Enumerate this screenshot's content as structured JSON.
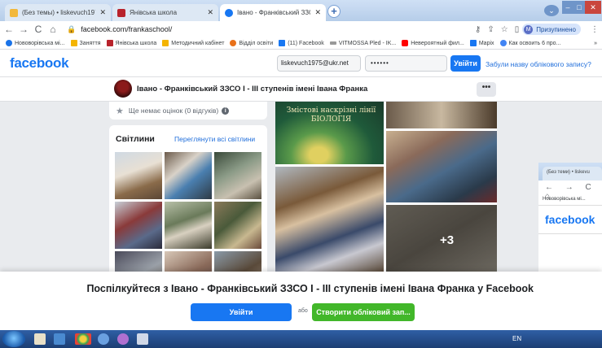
{
  "browser": {
    "tabs": [
      {
        "label": "(Без темы) • liskevuch1975@ukr.net",
        "active": false,
        "color": "#f2b83b"
      },
      {
        "label": "Янівська школа",
        "active": false,
        "color": "#b8232c"
      },
      {
        "label": "Івано - Франківський ЗЗСО І - ІІ",
        "active": true,
        "color": "#1877f2"
      }
    ],
    "new_tab": "+",
    "url": "facebook.com/frankaschool/",
    "profile_initial": "M",
    "profile_label": "Призупинено",
    "bookmarks": [
      {
        "label": "Нововорівська мі...",
        "color": "#1a73e8"
      },
      {
        "label": "Заняття",
        "color": "#f4b400"
      },
      {
        "label": "Янівська школа",
        "color": "#b8232c"
      },
      {
        "label": "Методичний кабінет",
        "color": "#f4b400"
      },
      {
        "label": "Відділ освіти",
        "color": "#e8711a"
      },
      {
        "label": "(11) Facebook",
        "color": "#1877f2"
      },
      {
        "label": "VITMOSSA Pled - IK...",
        "color": "#999999"
      },
      {
        "label": "Невероятный фил...",
        "color": "#ff0000"
      },
      {
        "label": "Mapix",
        "color": "#1877f2"
      },
      {
        "label": "Как освоить 6 про...",
        "color": "#4285f4"
      }
    ],
    "bookmarks_more": "»"
  },
  "fb": {
    "logo": "facebook",
    "email_value": "liskevuch1975@ukr.net",
    "password_value": "••••••",
    "login_label": "Увійти",
    "forgot_label": "Забули назву облікового запису?"
  },
  "page": {
    "title": "Івано - Франківський ЗЗСО І - ІІІ ступенів імені Івана Франка",
    "more_label": "•••",
    "rating_text": "Ще немає оцінок (0 відгуків)",
    "rating_info": "i",
    "photos_heading": "Світлини",
    "photos_all": "Переглянути всі світлини",
    "gallery_book_text": "Змістові наскрізні лінії БІОЛОГІЯ",
    "gallery_more": "+3"
  },
  "second_window": {
    "tab_label": "(Без теми) • liskevu",
    "nav": "← → C ⌂",
    "bookmark": "Нововорівська мі...",
    "logo": "facebook"
  },
  "cta": {
    "text": "Поспілкуйтеся з Івано - Франківський ЗЗСО І - ІІІ ступенів імені Івана Франка у Facebook",
    "login_label": "Увійти",
    "or_label": "або",
    "create_label": "Створити обліковий зап..."
  },
  "taskbar": {
    "tray_text": "EN"
  },
  "colors": {
    "fb_blue": "#1877f2",
    "fb_green": "#42b72a",
    "fb_bg": "#e9ebee"
  }
}
